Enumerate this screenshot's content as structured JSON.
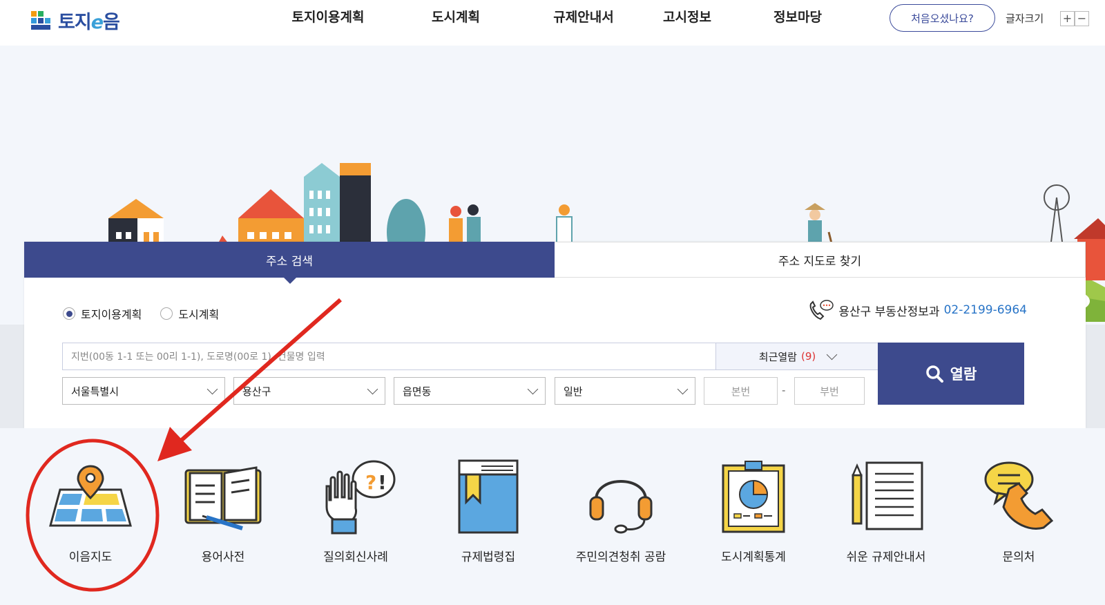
{
  "header": {
    "logo_text_pre": "토지",
    "logo_text_e": "e",
    "logo_text_post": "음",
    "nav": [
      "토지이용계획",
      "도시계획",
      "규제안내서",
      "고시정보",
      "정보마당"
    ],
    "first_visit": "처음오셨나요?",
    "font_size_label": "글자크기",
    "font_plus": "+",
    "font_minus": "−"
  },
  "search": {
    "tabs": [
      "주소 검색",
      "주소 지도로 찾기"
    ],
    "radio_land": "토지이용계획",
    "radio_city": "도시계획",
    "selected_radio": "토지이용계획",
    "contact_label": "용산구 부동산정보과",
    "contact_phone": "02-2199-6964",
    "input_placeholder": "지번(00동 1-1 또는 00리 1-1), 도로명(00로 1), 건물명 입력",
    "recent_label": "최근열람",
    "recent_count": "(9)",
    "selects": [
      "서울특별시",
      "용산구",
      "읍면동",
      "일반"
    ],
    "main_num_placeholder": "본번",
    "sub_num_placeholder": "부번",
    "dash": "-",
    "search_button": "열람"
  },
  "quick_menu": [
    {
      "label": "이음지도",
      "icon": "map-pin-icon"
    },
    {
      "label": "용어사전",
      "icon": "open-book-icon"
    },
    {
      "label": "질의회신사례",
      "icon": "hand-question-icon"
    },
    {
      "label": "규제법령집",
      "icon": "law-book-icon"
    },
    {
      "label": "주민의견청취 공람",
      "icon": "headset-icon"
    },
    {
      "label": "도시계획통계",
      "icon": "statistics-board-icon"
    },
    {
      "label": "쉬운 규제안내서",
      "icon": "document-pencil-icon"
    },
    {
      "label": "문의처",
      "icon": "phone-chat-icon"
    }
  ],
  "colors": {
    "primary": "#3d4a8d",
    "phone": "#2874c7",
    "annotation": "#e0281f"
  }
}
